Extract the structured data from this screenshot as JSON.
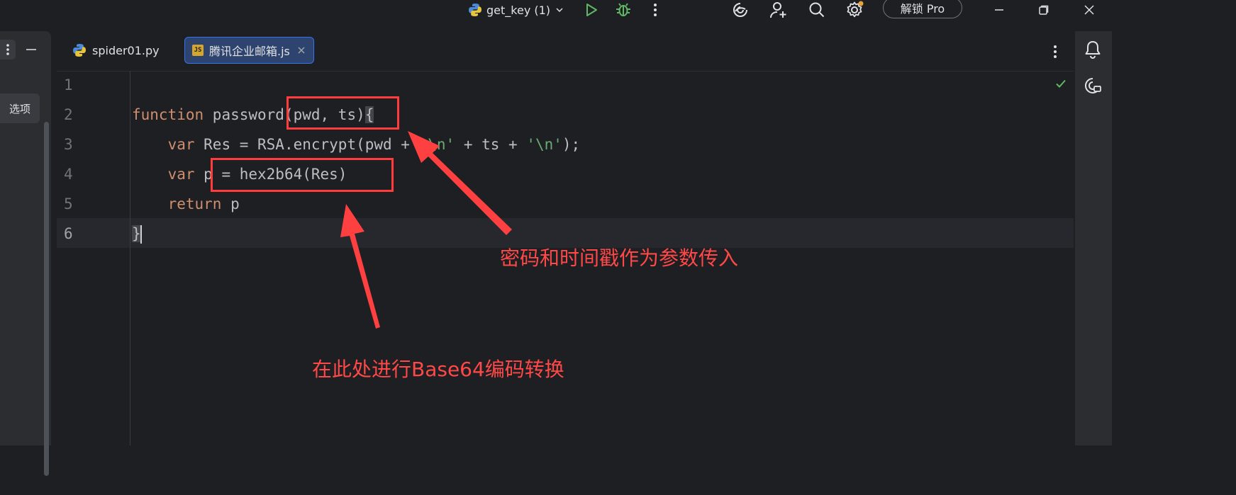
{
  "titlebar": {
    "run_config": "get_key (1)",
    "unlock_label": "解锁 Pro"
  },
  "left_panel": {
    "tooltip": "选项"
  },
  "tabs": [
    {
      "label": "spider01.py",
      "type": "python",
      "active": false
    },
    {
      "label": "腾讯企业邮箱.js",
      "type": "javascript",
      "active": true
    }
  ],
  "editor": {
    "line_numbers": [
      "1",
      "2",
      "3",
      "4",
      "5",
      "6"
    ],
    "current_line": 6,
    "lines": [
      {
        "segments": []
      },
      {
        "segments": [
          {
            "t": "function",
            "c": "kw"
          },
          {
            "t": " password(pwd, ts)",
            "c": ""
          },
          {
            "t": "{",
            "c": "brace-hl"
          }
        ]
      },
      {
        "segments": [
          {
            "t": "    ",
            "c": ""
          },
          {
            "t": "var",
            "c": "kw"
          },
          {
            "t": " Res = RSA.encrypt(pwd + ",
            "c": ""
          },
          {
            "t": "'\\n'",
            "c": "str"
          },
          {
            "t": " + ts + ",
            "c": ""
          },
          {
            "t": "'\\n'",
            "c": "str"
          },
          {
            "t": ");",
            "c": ""
          }
        ]
      },
      {
        "segments": [
          {
            "t": "    ",
            "c": ""
          },
          {
            "t": "var",
            "c": "kw"
          },
          {
            "t": " p = hex2b64(Res)",
            "c": ""
          }
        ]
      },
      {
        "segments": [
          {
            "t": "    ",
            "c": ""
          },
          {
            "t": "return",
            "c": "kw"
          },
          {
            "t": " p",
            "c": ""
          }
        ]
      },
      {
        "segments": [
          {
            "t": "}",
            "c": "brace-hl"
          }
        ]
      }
    ]
  },
  "annotations": {
    "params_note": "密码和时间戳作为参数传入",
    "base64_note": "在此处进行Base64编码转换"
  },
  "colors": {
    "annotation": "#ff3b3b",
    "keyword": "#cf8e6d",
    "string": "#6aab73",
    "accent": "#3574f0"
  },
  "icons": [
    "python-icon",
    "chevron-down-icon",
    "run-icon",
    "debug-icon",
    "more-vertical-icon",
    "ai-assistant-icon",
    "add-user-icon",
    "search-icon",
    "settings-icon",
    "minimize-icon",
    "restore-icon",
    "close-icon",
    "notifications-icon",
    "ai-chat-icon",
    "check-icon",
    "tab-close-icon"
  ]
}
